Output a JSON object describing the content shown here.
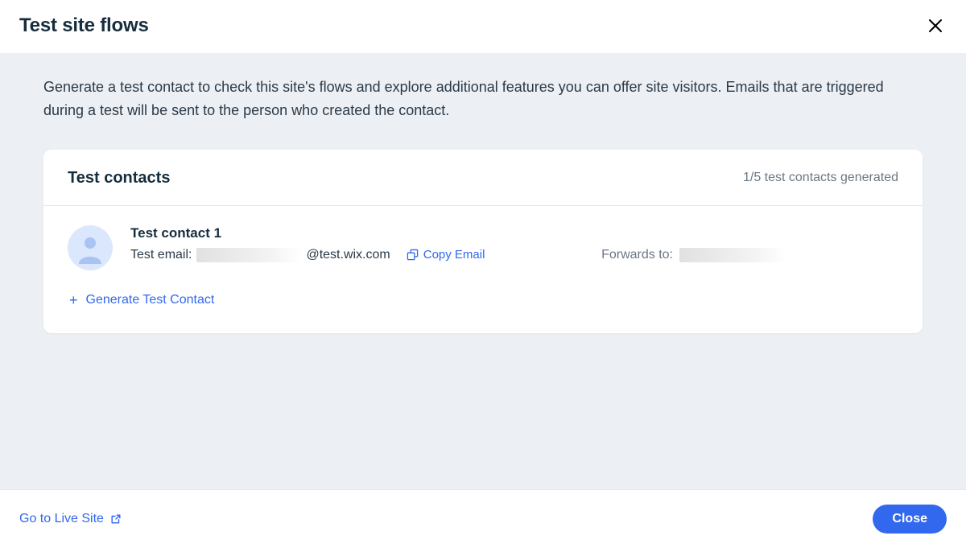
{
  "header": {
    "title": "Test site flows"
  },
  "intro": "Generate a test contact to check this site's flows and explore additional features you can offer site visitors. Emails that are triggered during a test will be sent to the person who created the contact.",
  "card": {
    "title": "Test contacts",
    "status": "1/5 test contacts generated",
    "contact": {
      "name": "Test contact 1",
      "email_label": "Test email:",
      "email_domain": "@test.wix.com",
      "copy": "Copy Email",
      "forwards_label": "Forwards to:"
    },
    "generate": "Generate Test Contact"
  },
  "footer": {
    "live": "Go to Live Site",
    "close": "Close"
  }
}
